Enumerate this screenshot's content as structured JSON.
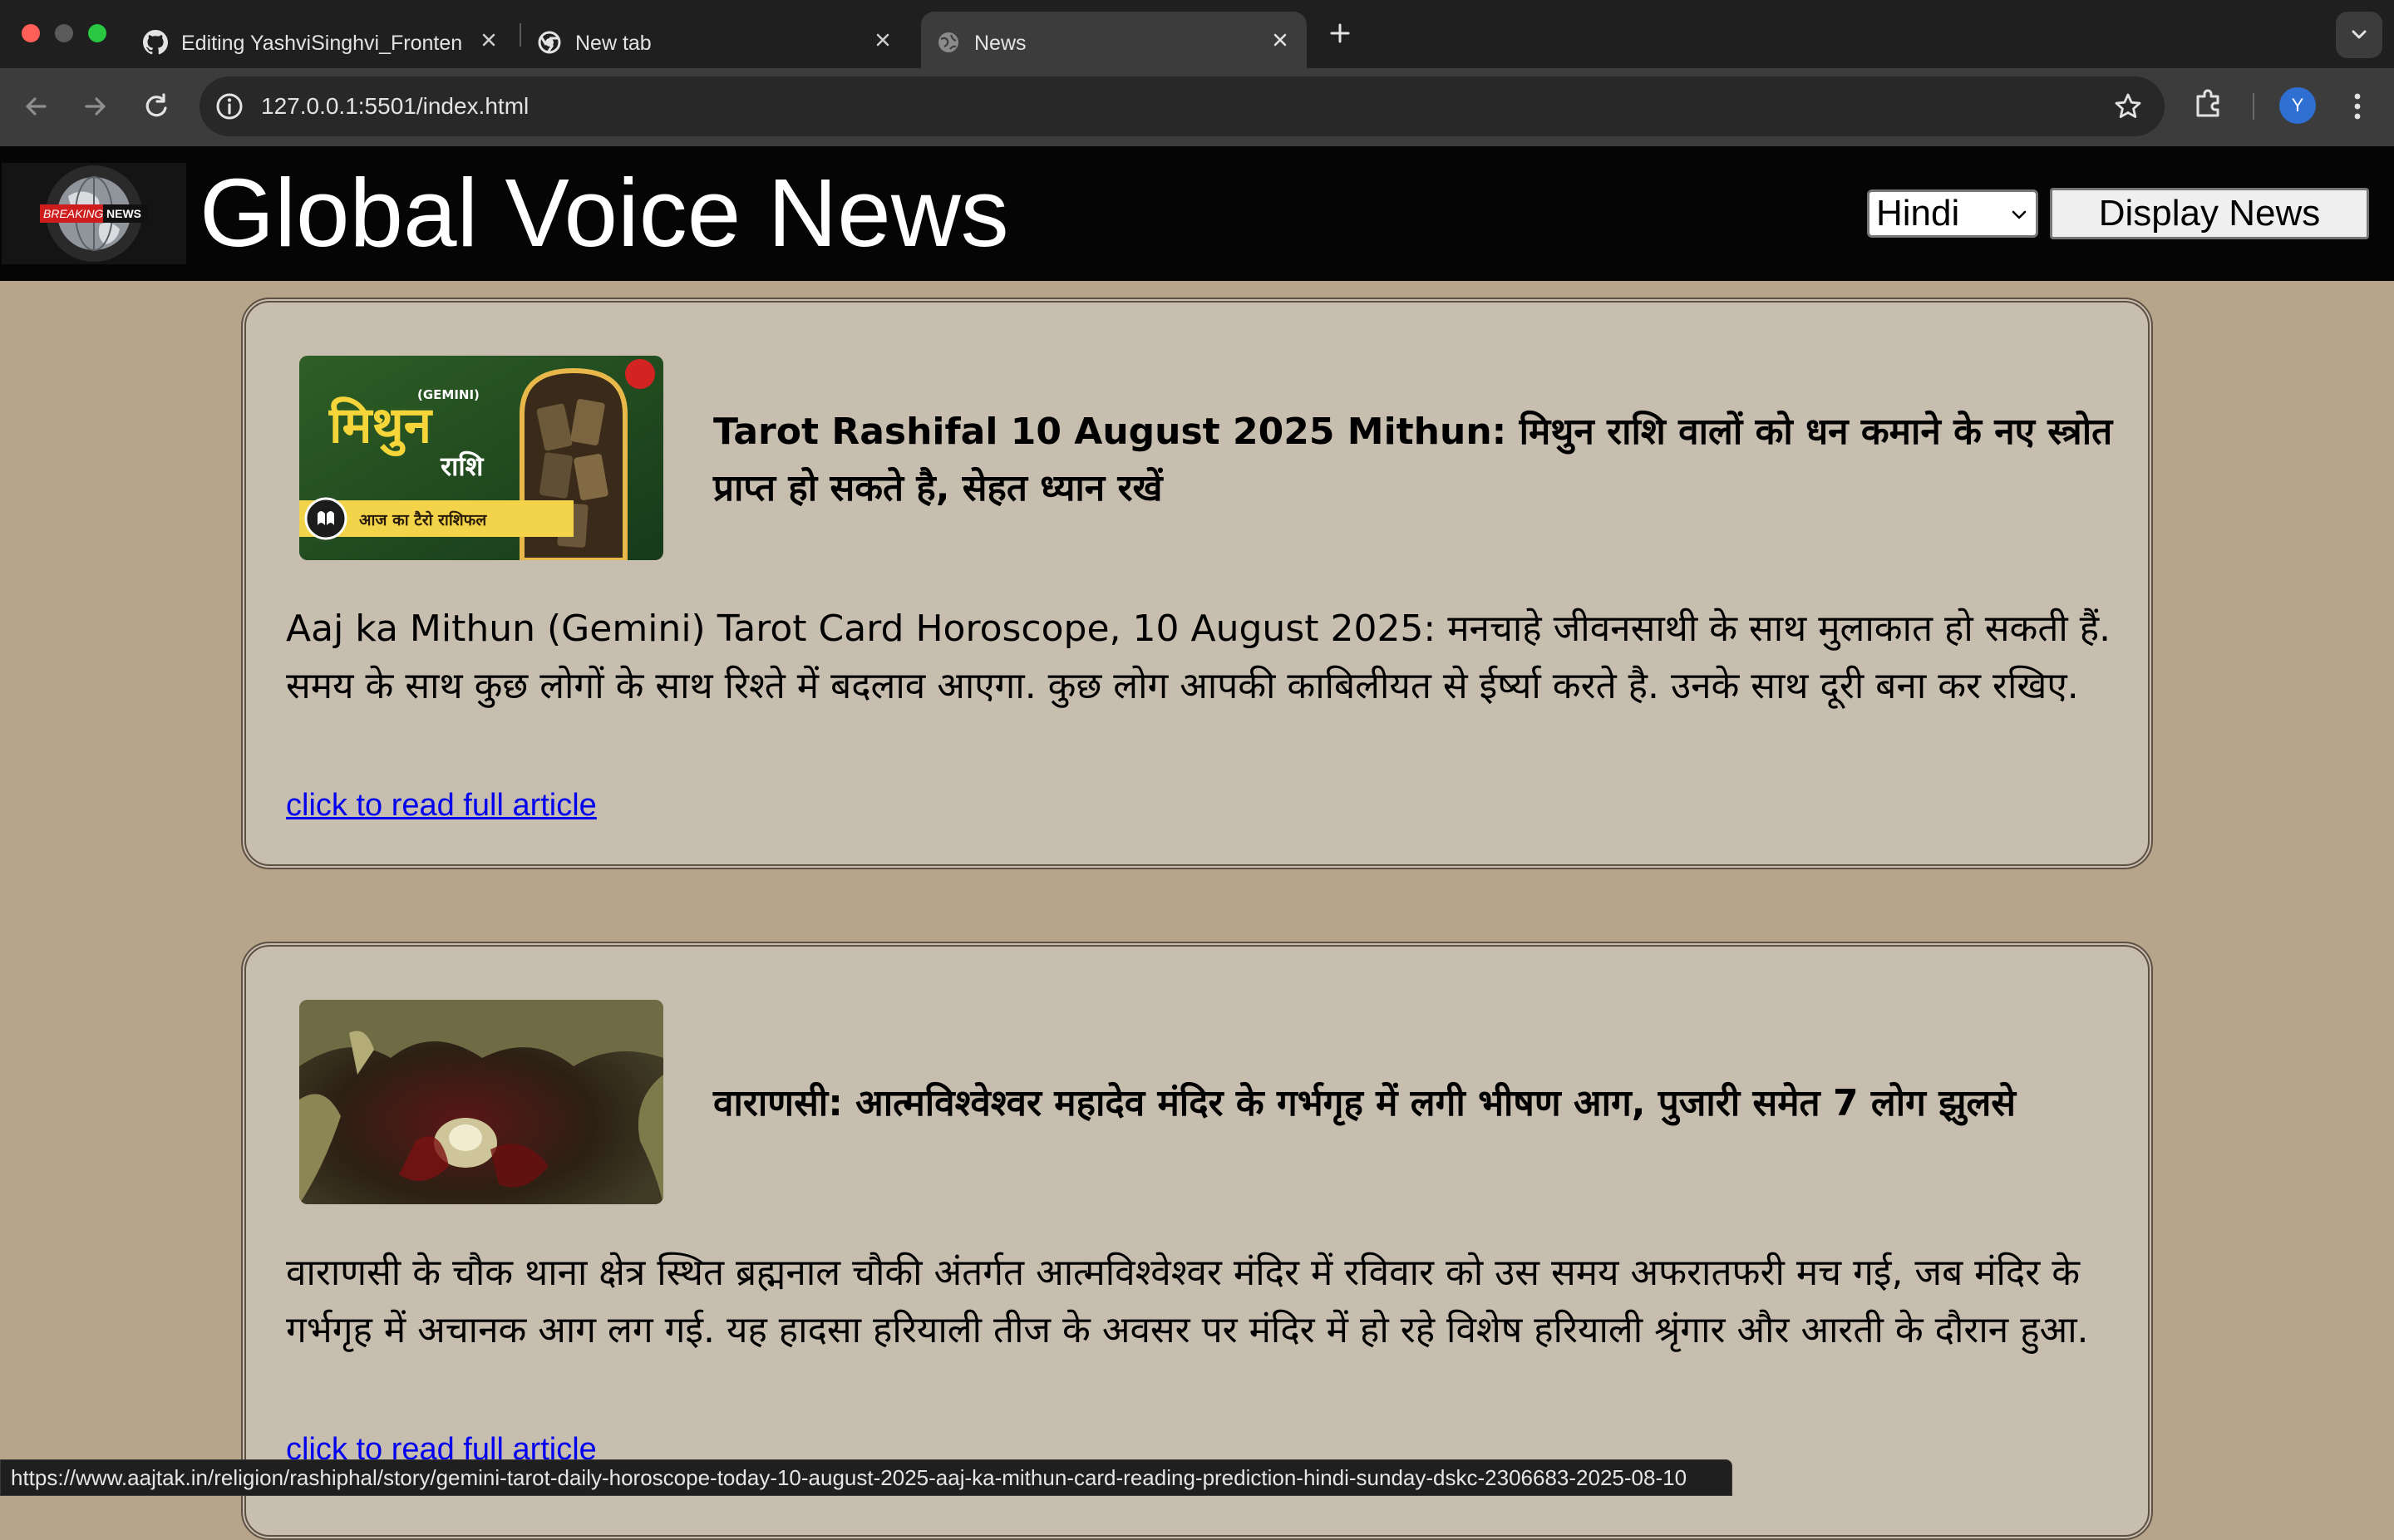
{
  "browser": {
    "tabs": [
      {
        "title": "Editing YashviSinghvi_Frontend",
        "icon": "github-icon"
      },
      {
        "title": "New tab",
        "icon": "chrome-icon"
      },
      {
        "title": "News",
        "icon": "globe-icon"
      }
    ],
    "active_tab": 2,
    "url": "127.0.0.1:5501/index.html",
    "profile_initial": "Y"
  },
  "site": {
    "logo_text_1": "BREAKING",
    "logo_text_2": "NEWS",
    "title": "Global Voice News",
    "language_selected": "Hindi",
    "display_button": "Display News"
  },
  "articles": [
    {
      "headline": "Tarot Rashifal 10 August 2025 Mithun: मिथुन राशि वालों को धन कमाने के नए स्त्रोत प्राप्त हो सकते है, सेहत ध्यान रखें",
      "description": "Aaj ka Mithun (Gemini) Tarot Card Horoscope, 10 August 2025: मनचाहे जीवनसाथी के साथ मुलाकात हो सकती हैं. समय के साथ कुछ लोगों के साथ रिश्ते में बदलाव आएगा. कुछ लोग आपकी काबिलीयत से ईर्ष्या करते है. उनके साथ दूरी बना कर रखिए.",
      "link_text": "click to read full article",
      "thumb": {
        "top_label": "(GEMINI)",
        "big_word": "मिथुन",
        "sub_word": "राशि",
        "strip": "आज का टैरो राशिफल"
      }
    },
    {
      "headline": "वाराणसी: आत्मविश्वेश्वर महादेव मंदिर के गर्भगृह में लगी भीषण आग, पुजारी समेत 7 लोग झुलसे",
      "description": "वाराणसी के चौक थाना क्षेत्र स्थित ब्रह्मनाल चौकी अंतर्गत आत्मविश्वेश्वर मंदिर में रविवार को उस समय अफरातफरी मच गई, जब मंदिर के गर्भगृह में अचानक आग लग गई. यह हादसा हरियाली तीज के अवसर पर मंदिर में हो रहे विशेष हरियाली श्रृंगार और आरती के दौरान हुआ.",
      "link_text": "click to read full article"
    }
  ],
  "status_bar": {
    "url": "https://www.aajtak.in/religion/rashiphal/story/gemini-tarot-daily-horoscope-today-10-august-2025-aaj-ka-mithun-card-reading-prediction-hindi-sunday-dskc-2306683-2025-08-10"
  }
}
